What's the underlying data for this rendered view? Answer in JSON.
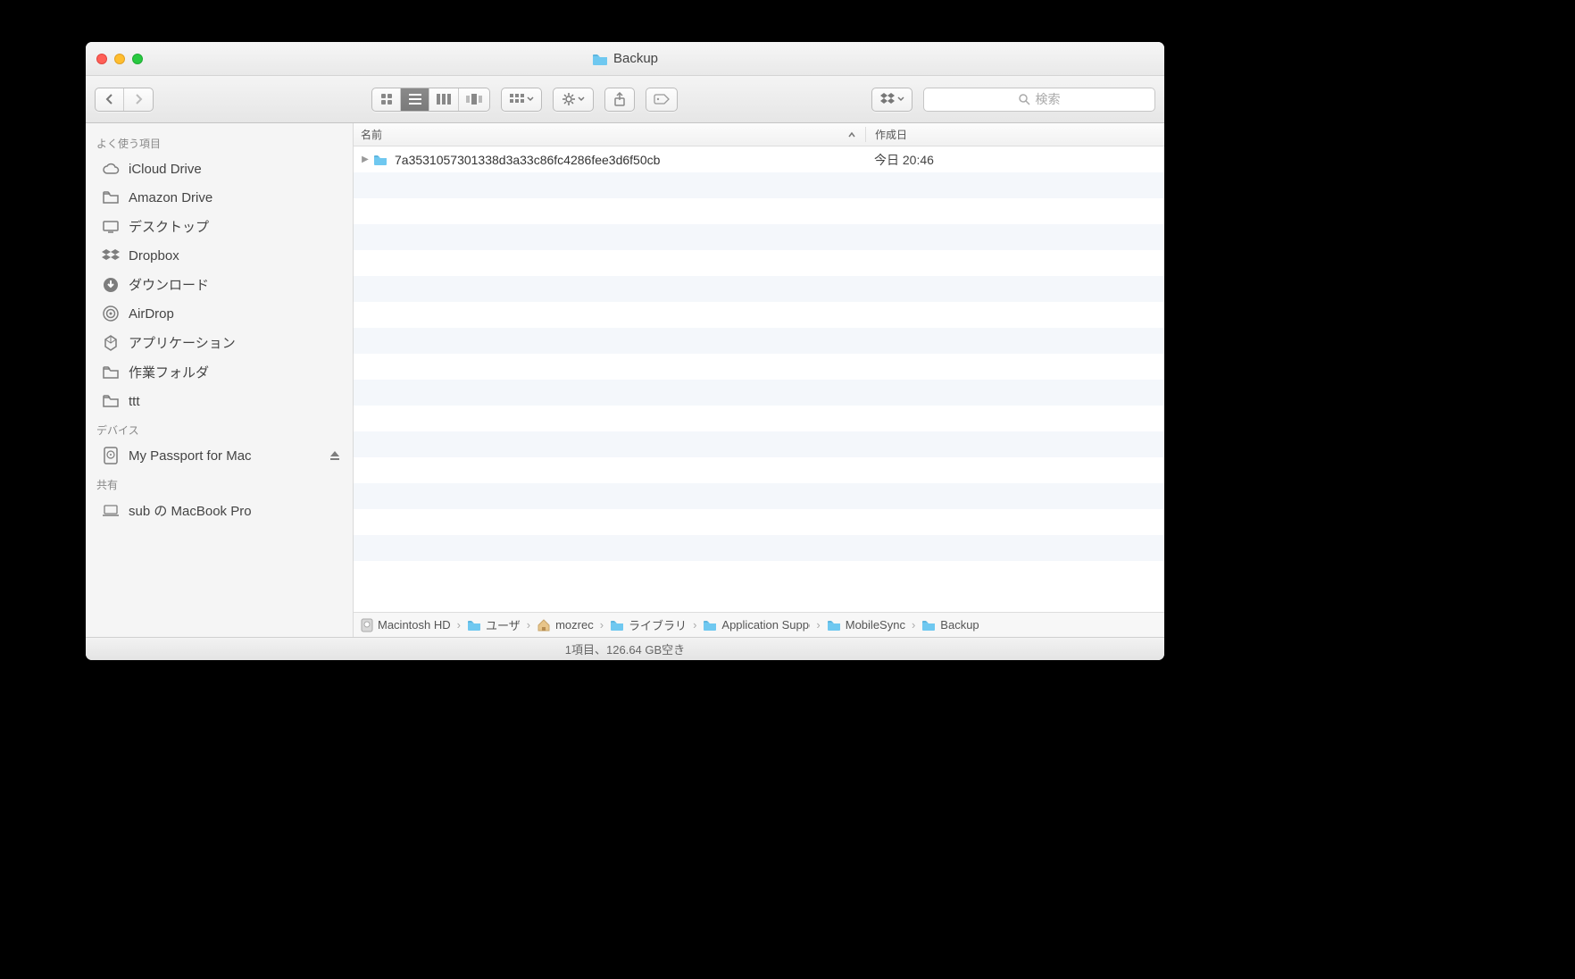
{
  "window": {
    "title": "Backup"
  },
  "toolbar": {
    "search_placeholder": "検索"
  },
  "sidebar": {
    "headings": {
      "favorites": "よく使う項目",
      "devices": "デバイス",
      "shared": "共有"
    },
    "favorites": [
      {
        "label": "iCloud Drive",
        "icon": "cloud"
      },
      {
        "label": "Amazon Drive",
        "icon": "folder"
      },
      {
        "label": "デスクトップ",
        "icon": "desktop"
      },
      {
        "label": "Dropbox",
        "icon": "dropbox"
      },
      {
        "label": "ダウンロード",
        "icon": "download"
      },
      {
        "label": "AirDrop",
        "icon": "airdrop"
      },
      {
        "label": "アプリケーション",
        "icon": "apps"
      },
      {
        "label": "作業フォルダ",
        "icon": "folder"
      },
      {
        "label": "ttt",
        "icon": "folder"
      }
    ],
    "devices": [
      {
        "label": "My Passport for Mac",
        "icon": "hdd",
        "eject": true
      }
    ],
    "shared": [
      {
        "label": "sub の MacBook Pro",
        "icon": "laptop"
      }
    ]
  },
  "columns": {
    "name": "名前",
    "created": "作成日"
  },
  "rows": [
    {
      "name": "7a3531057301338d3a33c86fc4286fee3d6f50cb",
      "date": "今日 20:46"
    }
  ],
  "path": [
    {
      "label": "Macintosh HD",
      "icon": "hdd"
    },
    {
      "label": "ユーザ",
      "icon": "folder-blue"
    },
    {
      "label": "mozrec",
      "icon": "home"
    },
    {
      "label": "ライブラリ",
      "icon": "folder-blue"
    },
    {
      "label": "Application Support",
      "icon": "folder-blue"
    },
    {
      "label": "MobileSync",
      "icon": "folder-blue"
    },
    {
      "label": "Backup",
      "icon": "folder-blue"
    }
  ],
  "status": "1項目、126.64 GB空き"
}
